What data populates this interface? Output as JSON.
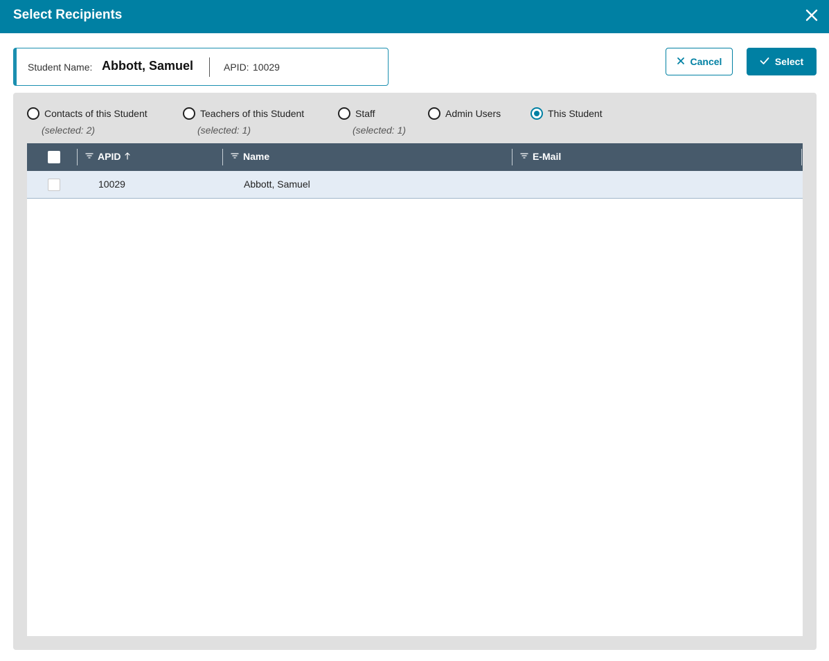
{
  "dialog": {
    "title": "Select Recipients"
  },
  "student_info": {
    "name_label": "Student Name:",
    "name_value": "Abbott, Samuel",
    "apid_label": "APID:",
    "apid_value": "10029"
  },
  "actions": {
    "cancel_label": "Cancel",
    "select_label": "Select"
  },
  "recipient_types": [
    {
      "label": "Contacts of this Student",
      "sub": "(selected: 2)",
      "checked": false
    },
    {
      "label": "Teachers of this Student",
      "sub": "(selected: 1)",
      "checked": false
    },
    {
      "label": "Staff",
      "sub": "(selected: 1)",
      "checked": false
    },
    {
      "label": "Admin Users",
      "sub": "",
      "checked": false
    },
    {
      "label": "This Student",
      "sub": "",
      "checked": true
    }
  ],
  "grid": {
    "columns": [
      {
        "label": "APID",
        "sort": "ascending"
      },
      {
        "label": "Name"
      },
      {
        "label": "E-Mail"
      }
    ],
    "rows": [
      {
        "apid": "10029",
        "name": "Abbott, Samuel",
        "email": ""
      }
    ]
  },
  "colors": {
    "primary": "#0080a3",
    "grid_header": "#475a6b",
    "selected_row": "#e4ecf5",
    "panel": "#e0e0e0"
  }
}
